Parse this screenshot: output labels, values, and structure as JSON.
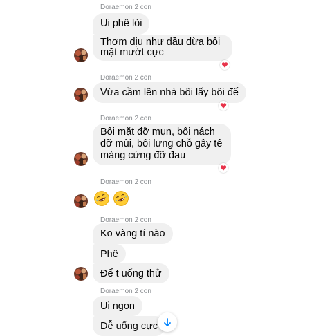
{
  "sender_label": "Doraemon 2 con",
  "groups": [
    {
      "messages": [
        "Ui phê lòi",
        "Thơm dịu như dầu dừa bôi mặt mướt cực"
      ],
      "reaction": "❤️"
    },
    {
      "messages": [
        "Vừa cầm lên nhà bôi lấy bôi để"
      ],
      "reaction": "❤️"
    },
    {
      "messages": [
        "Bôi mặt đỡ mụn, bôi nách đỡ mùi, bôi lưng chỗ gây tê màng cứng đỡ đau"
      ],
      "reaction": "❤️"
    },
    {
      "messages": [
        "🤣🤣"
      ],
      "emojis": [
        "rolling-on-floor-laughing",
        "rolling-on-floor-laughing"
      ]
    },
    {
      "messages": [
        "Ko vàng tí nào",
        "Phê",
        "Để t uống thử"
      ]
    },
    {
      "messages": [
        "Ui ngon",
        "Dễ uống cực"
      ]
    }
  ],
  "scroll_button": {
    "icon": "arrow-down-icon",
    "color": "#0084ff"
  },
  "colors": {
    "bubble": "#f0f0f0",
    "sender": "#8a8d91",
    "heart": "#e8334a"
  }
}
